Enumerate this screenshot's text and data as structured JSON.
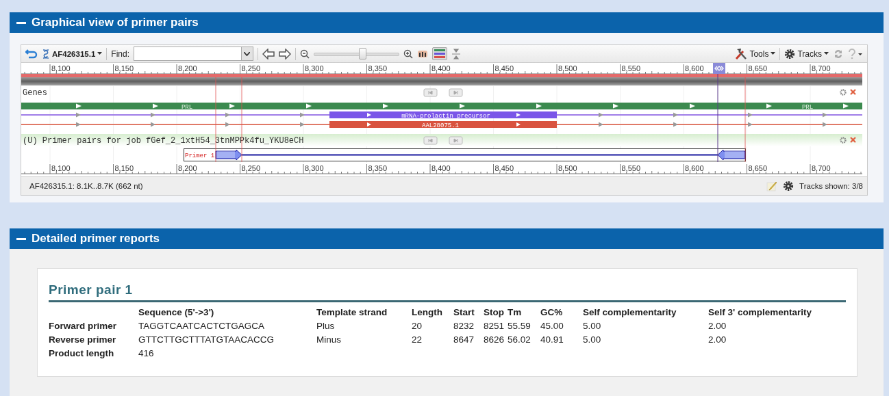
{
  "sections": [
    {
      "title": "Graphical view of primer pairs",
      "expanded": true
    },
    {
      "title": "Detailed primer reports",
      "expanded": true
    }
  ],
  "viewer": {
    "toolbar": {
      "accession": "AF426315.1",
      "find_label": "Find:",
      "zoom": {
        "level": 0.57
      },
      "tools": "Tools",
      "tracks": "Tracks"
    },
    "ruler": [
      "8,100",
      "8,150",
      "8,200",
      "8,250",
      "8,300",
      "8,350",
      "8,400",
      "8,450",
      "8,500",
      "8,550",
      "8,600",
      "8,650",
      "8,700"
    ],
    "tracks": [
      {
        "kind": "genes",
        "title": "Genes",
        "features": [
          {
            "kind": "gene",
            "labels": [
              "PRL",
              "PRL"
            ]
          },
          {
            "kind": "mrna",
            "label": "mRNA-prolactin precursor"
          },
          {
            "kind": "cds",
            "label": "AAL28075.1"
          }
        ]
      },
      {
        "kind": "primers",
        "title": "(U) Primer pairs for job fGef_2_1xtH54_3tnMPPk4fu_YKU8eCH",
        "primer_label": "Primer 1"
      }
    ],
    "bottom_ruler": [
      "8,100",
      "8,150",
      "8,200",
      "8,250",
      "8,300",
      "8,350",
      "8,400",
      "8,450",
      "8,500",
      "8,550",
      "8,600",
      "8,650",
      "8,700"
    ],
    "status": "AF426315.1: 8.1K..8.7K (662 nt)",
    "tracks_shown": "Tracks shown: 3/8"
  },
  "report": {
    "title": "Primer pair 1",
    "columns": [
      "",
      "Sequence (5'->3')",
      "Template strand",
      "Length",
      "Start",
      "Stop",
      "Tm",
      "GC%",
      "Self complementarity",
      "Self 3' complementarity"
    ],
    "rows": [
      [
        "Forward primer",
        "TAGGTCAATCACTCTGAGCA",
        "Plus",
        "20",
        "8232",
        "8251",
        "55.59",
        "45.00",
        "5.00",
        "2.00"
      ],
      [
        "Reverse primer",
        "GTTCTTGCTTTATGTAACACCG",
        "Minus",
        "22",
        "8647",
        "8626",
        "56.02",
        "40.91",
        "5.00",
        "2.00"
      ],
      [
        "Product length",
        "416"
      ]
    ]
  }
}
